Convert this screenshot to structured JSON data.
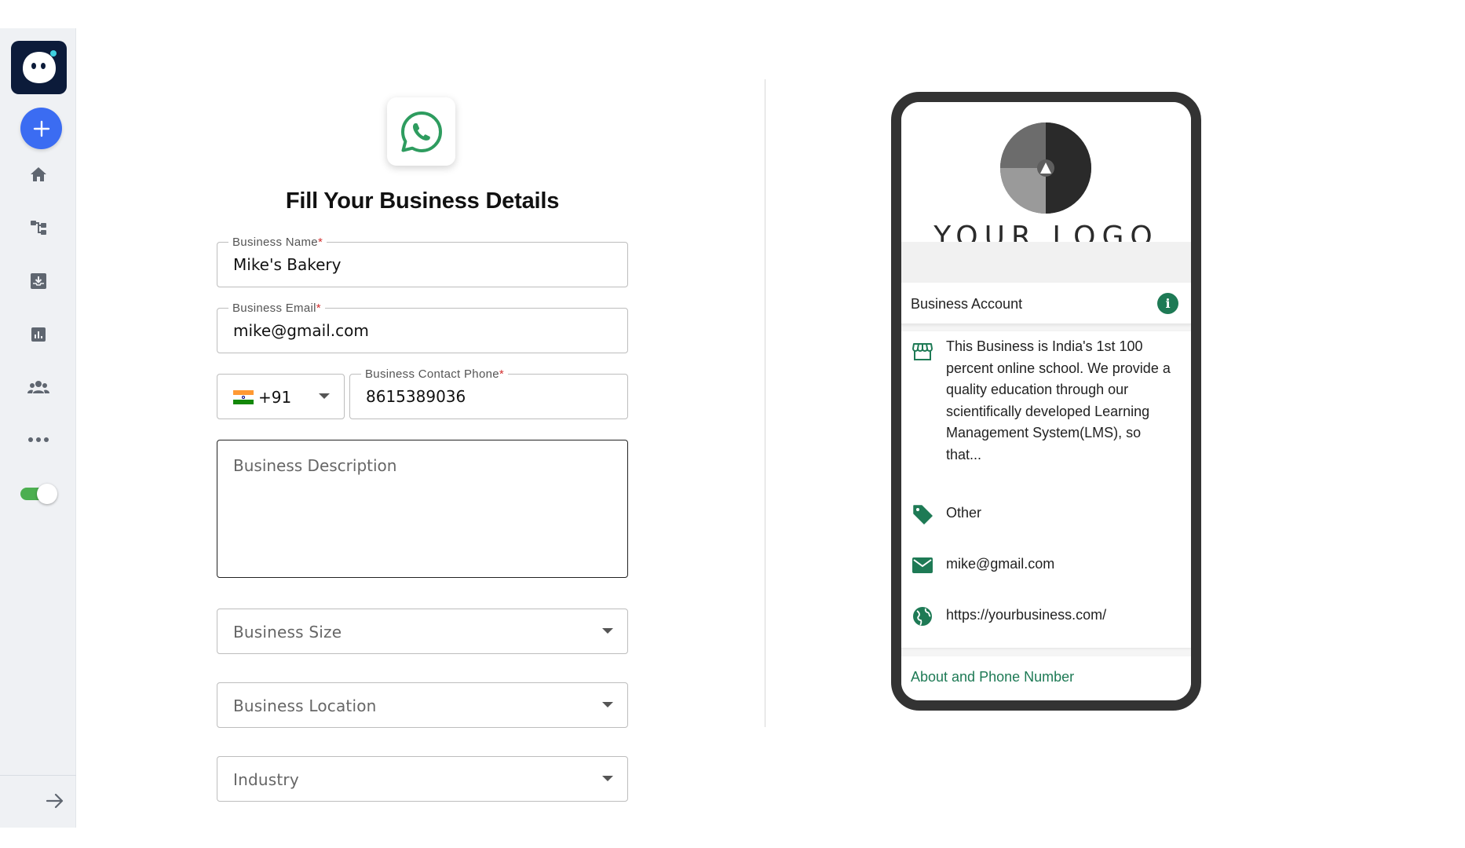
{
  "form": {
    "title": "Fill Your Business Details",
    "business_name": {
      "label": "Business Name",
      "required": "*",
      "value": "Mike's Bakery"
    },
    "business_email": {
      "label": "Business Email",
      "required": "*",
      "value": "mike@gmail.com"
    },
    "country_code": "+91",
    "contact_phone": {
      "label": "Business Contact Phone",
      "required": "*",
      "value": "8615389036"
    },
    "description": {
      "placeholder": "Business Description"
    },
    "business_size": {
      "placeholder": "Business Size"
    },
    "business_location": {
      "placeholder": "Business Location"
    },
    "industry": {
      "placeholder": "Industry"
    }
  },
  "preview": {
    "logo_text": "YOUR LOGO",
    "account_label": "Business Account",
    "info_glyph": "i",
    "description": "This Business is India's 1st 100 percent online school. We provide a quality education through our scientifically developed Learning Management System(LMS), so that...",
    "category": "Other",
    "email": "mike@gmail.com",
    "website": "https://yourbusiness.com/",
    "footer_link": "About and Phone Number"
  },
  "colors": {
    "accent_blue": "#3b6cf2",
    "whatsapp_green": "#1e7a55",
    "toggle_green": "#4caf50",
    "sidebar_bg": "#eff1f4"
  }
}
